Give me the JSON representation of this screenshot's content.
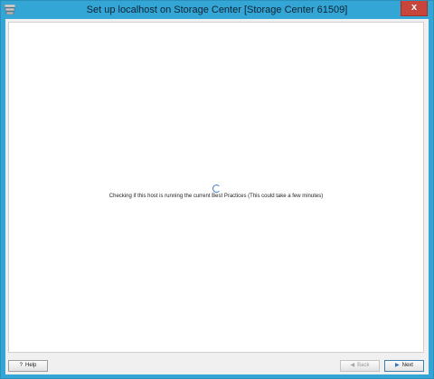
{
  "window": {
    "title": "Set up localhost on Storage Center [Storage Center 61509]",
    "close_label": "x"
  },
  "main": {
    "status_text": "Checking if this host is running the current Best Practices (This could take a few minutes)"
  },
  "footer": {
    "help_label": "Help",
    "help_icon_glyph": "?",
    "back_label": "Back",
    "next_label": "Next"
  }
}
